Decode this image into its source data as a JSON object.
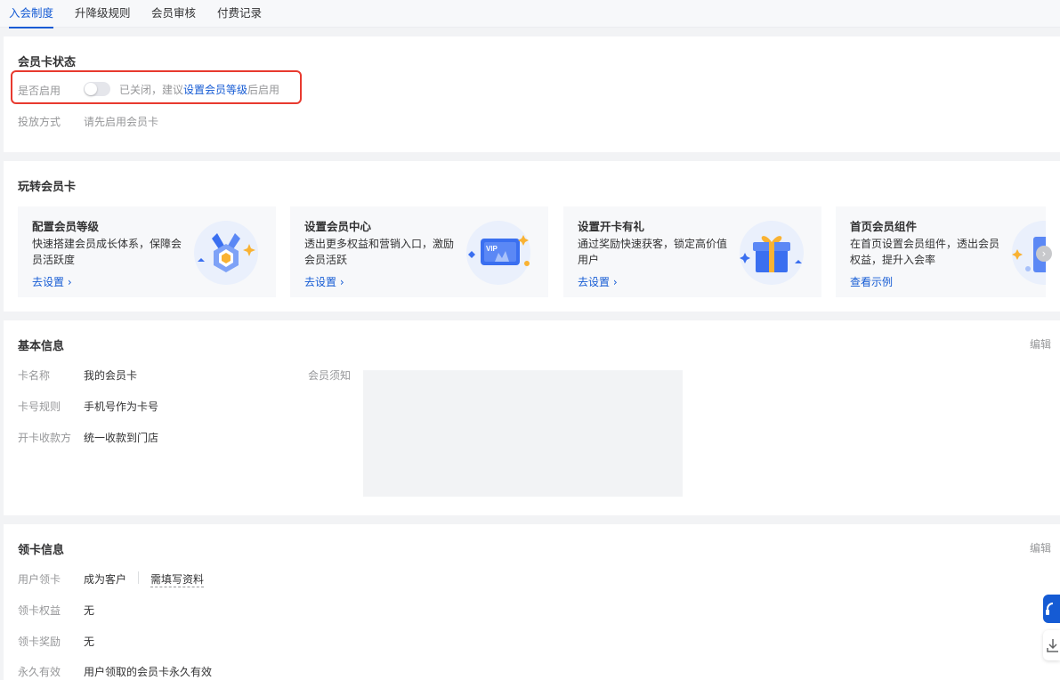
{
  "tabs": [
    {
      "label": "入会制度",
      "active": true
    },
    {
      "label": "升降级规则",
      "active": false
    },
    {
      "label": "会员审核",
      "active": false
    },
    {
      "label": "付费记录",
      "active": false
    }
  ],
  "card_status": {
    "title": "会员卡状态",
    "enable_label": "是否启用",
    "enabled": false,
    "hint_prefix": "已关闭，建议",
    "hint_link": "设置会员等级",
    "hint_suffix": "后启用",
    "delivery_label": "投放方式",
    "delivery_value": "请先启用会员卡"
  },
  "play": {
    "title": "玩转会员卡",
    "features": [
      {
        "title": "配置会员等级",
        "desc": "快速搭建会员成长体系，保障会员活跃度",
        "link": "去设置 ›",
        "icon": "medal-icon"
      },
      {
        "title": "设置会员中心",
        "desc": "透出更多权益和营销入口，激励会员活跃",
        "link": "去设置 ›",
        "icon": "vip-card-icon",
        "badge": "VIP"
      },
      {
        "title": "设置开卡有礼",
        "desc": "通过奖励快速获客，锁定高价值用户",
        "link": "去设置 ›",
        "icon": "gift-icon"
      },
      {
        "title": "首页会员组件",
        "desc": "在首页设置会员组件，透出会员权益，提升入会率",
        "link": "查看示例",
        "icon": "component-icon"
      }
    ]
  },
  "basic": {
    "title": "基本信息",
    "edit": "编辑",
    "name_label": "卡名称",
    "name_value": "我的会员卡",
    "rule_label": "卡号规则",
    "rule_value": "手机号作为卡号",
    "pay_label": "开卡收款方",
    "pay_value": "统一收款到门店",
    "notice_label": "会员须知"
  },
  "claim": {
    "title": "领卡信息",
    "edit": "编辑",
    "user_label": "用户领卡",
    "user_value": "成为客户",
    "user_extra": "需填写资料",
    "rights_label": "领卡权益",
    "rights_value": "无",
    "reward_label": "领卡奖励",
    "reward_value": "无",
    "valid_label": "永久有效",
    "valid_value": "用户领取的会员卡永久有效"
  },
  "colors": {
    "accent": "#155bd4",
    "highlight_border": "#e83a2f"
  }
}
